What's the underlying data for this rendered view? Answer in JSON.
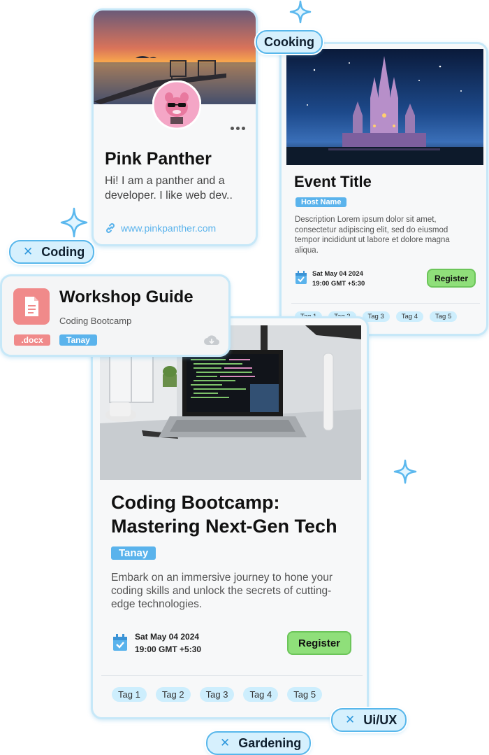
{
  "chips": {
    "cooking": "Cooking",
    "coding": "Coding",
    "uiux": "Ui/UX",
    "gardening": "Gardening"
  },
  "icons": {
    "close": "close-icon",
    "sparkle": "sparkle-icon",
    "link": "link-icon",
    "calendar": "calendar-check-icon",
    "document": "document-icon",
    "cloud": "cloud-download-icon",
    "more": "more-options-icon"
  },
  "colors": {
    "card_border": "#c7e8f8",
    "chip_fill": "#d6f0fd",
    "chip_border": "#58b7eb",
    "accent_blue": "#5ab3ec",
    "register_green": "#8fdf7a",
    "doc_red": "#f08a8a"
  },
  "profile": {
    "name": "Pink Panther",
    "bio_line1": "Hi! I am a panther and a",
    "bio_line2": "developer. I like web dev..",
    "link": "www.pinkpanther.com"
  },
  "event_small": {
    "title": "Event Title",
    "host": "Host Name",
    "description": "Description Lorem ipsum dolor sit amet, consectetur adipiscing elit, sed do eiusmod tempor incididunt ut labore et dolore magna aliqua.",
    "date": "Sat May 04 2024",
    "time": "19:00 GMT +5:30",
    "register": "Register",
    "tags": [
      "Tag 1",
      "Tag 2",
      "Tag 3",
      "Tag 4",
      "Tag 5"
    ]
  },
  "doc": {
    "title": "Workshop Guide",
    "subtitle": "Coding Bootcamp",
    "ext": ".docx",
    "author": "Tanay"
  },
  "event_large": {
    "title_line1": "Coding Bootcamp:",
    "title_line2": "Mastering Next-Gen Tech",
    "host": "Tanay",
    "desc_line1": "Embark on an immersive journey to hone your",
    "desc_line2": "coding skills and unlock the secrets of cutting-",
    "desc_line3": "edge technologies.",
    "date": "Sat May 04 2024",
    "time": "19:00 GMT +5:30",
    "register": "Register",
    "tags": [
      "Tag 1",
      "Tag 2",
      "Tag 3",
      "Tag 4",
      "Tag 5"
    ]
  }
}
